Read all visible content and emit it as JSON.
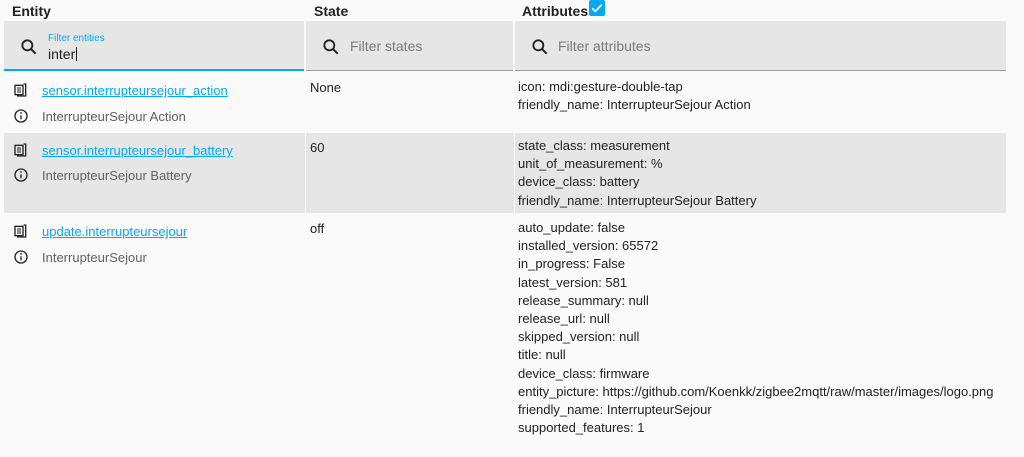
{
  "headers": {
    "entity": "Entity",
    "state": "State",
    "attributes": "Attributes"
  },
  "attributes_checkbox_checked": true,
  "filters": {
    "entity": {
      "label": "Filter entities",
      "value": "inter"
    },
    "state": {
      "placeholder": "Filter states"
    },
    "attributes": {
      "placeholder": "Filter attributes"
    }
  },
  "colors": {
    "accent": "#03a9f4",
    "row_alt": "#e6e6e6"
  },
  "rows": [
    {
      "entity_id": "sensor.interrupteursejour_action",
      "friendly": "InterrupteurSejour Action",
      "state": "None",
      "attributes": [
        "icon: mdi:gesture-double-tap",
        "friendly_name: InterrupteurSejour Action"
      ]
    },
    {
      "entity_id": "sensor.interrupteursejour_battery",
      "friendly": "InterrupteurSejour Battery",
      "state": "60",
      "attributes": [
        "state_class: measurement",
        "unit_of_measurement: %",
        "device_class: battery",
        "friendly_name: InterrupteurSejour Battery"
      ]
    },
    {
      "entity_id": "update.interrupteursejour",
      "friendly": "InterrupteurSejour",
      "state": "off",
      "attributes": [
        "auto_update: false",
        "installed_version: 65572",
        "in_progress: False",
        "latest_version: 581",
        "release_summary: null",
        "release_url: null",
        "skipped_version: null",
        "title: null",
        "device_class: firmware",
        "entity_picture: https://github.com/Koenkk/zigbee2mqtt/raw/master/images/logo.png",
        "friendly_name: InterrupteurSejour",
        "supported_features: 1"
      ]
    }
  ]
}
